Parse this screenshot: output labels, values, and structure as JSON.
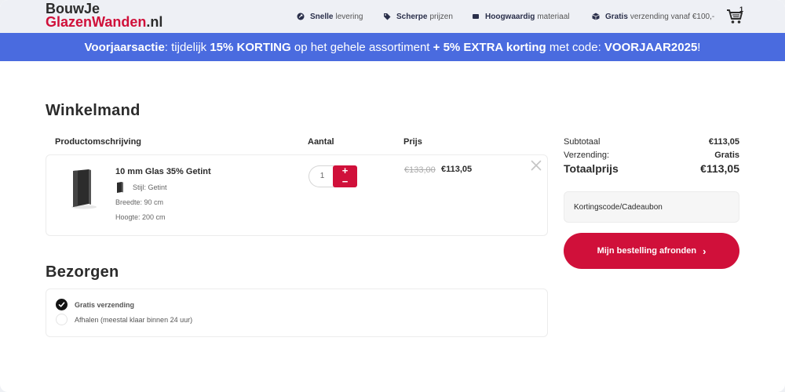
{
  "header": {
    "logo_line1": "BouwJe",
    "logo_line2_red": "GlazenWanden",
    "logo_line2_suffix": ".nl",
    "usps": [
      {
        "icon": "rocket-icon",
        "bold": "Snelle",
        "text": "levering"
      },
      {
        "icon": "tag-icon",
        "bold": "Scherpe",
        "text": "prijzen"
      },
      {
        "icon": "layers-icon",
        "bold": "Hoogwaardig",
        "text": "materiaal"
      },
      {
        "icon": "box-icon",
        "bold": "Gratis",
        "text": "verzending vanaf €100,-"
      }
    ],
    "cart_count": "1"
  },
  "promo": {
    "p1": "Voorjaarsactie",
    "p2": ": tijdelijk ",
    "p3": "15% KORTING",
    "p4": " op het gehele assortiment ",
    "p5": "+ 5% EXTRA korting",
    "p6": " met code: ",
    "p7": "VOORJAAR2025",
    "p8": "!"
  },
  "cart": {
    "title": "Winkelmand",
    "columns": {
      "product": "Productomschrijving",
      "quantity": "Aantal",
      "price": "Prijs"
    },
    "item": {
      "name": "10 mm Glas 35% Getint",
      "style": "Stijl: Getint",
      "width": "Breedte: 90 cm",
      "height": "Hoogte: 200 cm",
      "quantity": "1",
      "plus": "+",
      "minus": "−",
      "old_price": "€133,00",
      "price": "€113,05"
    }
  },
  "delivery": {
    "title": "Bezorgen",
    "options": [
      {
        "label": "Gratis verzending",
        "selected": true
      },
      {
        "label": "Afhalen (meestal klaar binnen 24 uur)",
        "selected": false
      }
    ]
  },
  "summary": {
    "subtotal_label": "Subtotaal",
    "subtotal_value": "€113,05",
    "shipping_label": "Verzending:",
    "shipping_value": "Gratis",
    "total_label": "Totaalprijs",
    "total_value": "€113,05",
    "coupon_label": "Kortingscode/Cadeaubon",
    "checkout_label": "Mijn bestelling afronden",
    "checkout_chevron": "›"
  },
  "colors": {
    "brand_red": "#d0103a",
    "promo_blue": "#4a6bdf",
    "text_dark": "#2b2b2b"
  }
}
